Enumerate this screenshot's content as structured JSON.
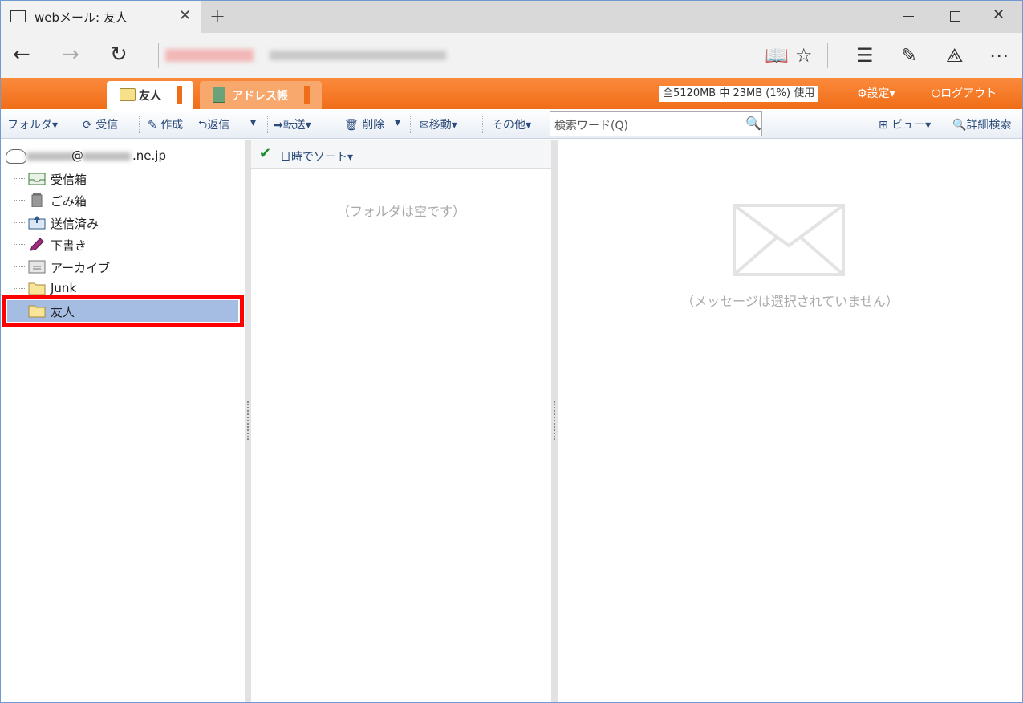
{
  "browser": {
    "tab_title": "webメール: 友人",
    "tab_close": "✕",
    "new_tab": "+",
    "close": "✕"
  },
  "app_tabs": {
    "friends_label": "友人",
    "address_label": "アドレス帳"
  },
  "header": {
    "quota": "全5120MB 中 23MB (1%) 使用",
    "settings_label": "設定▾",
    "logout_label": "ログアウト"
  },
  "toolbar": {
    "folder_label": "フォルダ▾",
    "receive_label": "受信",
    "compose_label": "作成",
    "reply_label": "返信",
    "reply_dropdown": "▾",
    "forward_label": "転送▾",
    "delete_label": "削除",
    "delete_dropdown": "▾",
    "move_label": "移動▾",
    "other_label": "その他▾",
    "search_placeholder": "検索ワード(Q)",
    "view_label": "ビュー▾",
    "advanced_search_label": "詳細検索"
  },
  "account": {
    "at": "@",
    "domain_suffix": ".ne.jp"
  },
  "folders": [
    {
      "label": "受信箱",
      "icon": "inbox-icon"
    },
    {
      "label": "ごみ箱",
      "icon": "trash-icon"
    },
    {
      "label": "送信済み",
      "icon": "sent-icon"
    },
    {
      "label": "下書き",
      "icon": "draft-pencil-icon"
    },
    {
      "label": "アーカイブ",
      "icon": "archive-icon"
    },
    {
      "label": "Junk",
      "icon": "folder-icon"
    },
    {
      "label": "友人",
      "icon": "folder-icon"
    }
  ],
  "message_list": {
    "sort_label": "日時でソート▾",
    "empty_text": "（フォルダは空です）"
  },
  "preview": {
    "empty_text": "（メッセージは選択されていません）"
  },
  "colors": {
    "accent": "#f06d18",
    "selection": "#a6bde3",
    "highlight_box": "#ff0000"
  }
}
